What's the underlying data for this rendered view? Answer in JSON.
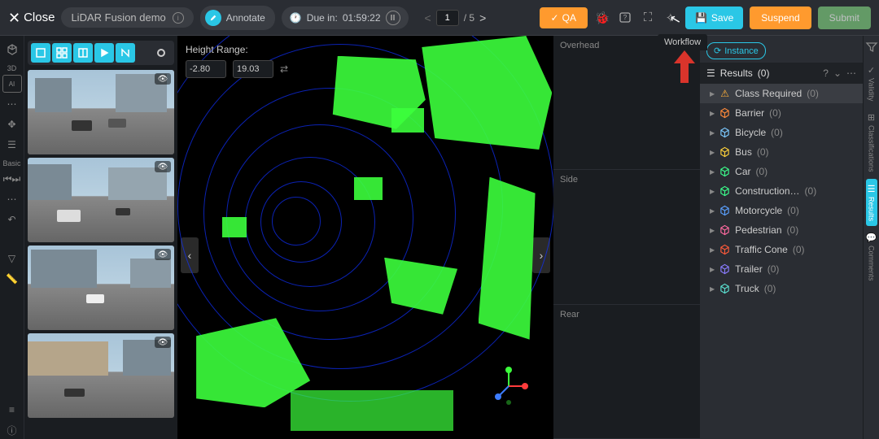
{
  "header": {
    "close": "Close",
    "title": "LiDAR Fusion demo",
    "annotate": "Annotate",
    "due_label": "Due in:",
    "due_time": "01:59:22",
    "page_current": "1",
    "page_total": "/ 5",
    "qa": "QA",
    "save": "Save",
    "suspend": "Suspend",
    "submit": "Submit"
  },
  "left_rail": {
    "label_3d": "3D",
    "label_basic": "Basic"
  },
  "height_range": {
    "label": "Height Range:",
    "min": "-2.80",
    "max": "19.03"
  },
  "ortho": {
    "overhead": "Overhead",
    "side": "Side",
    "rear": "Rear"
  },
  "panel": {
    "workflow": "Workflow",
    "instance": "Instance",
    "results_label": "Results",
    "results_count": "(0)",
    "rows": [
      {
        "label": "Class Required",
        "count": "(0)",
        "warn": true,
        "color": "#ffb03a"
      },
      {
        "label": "Barrier",
        "count": "(0)",
        "color": "#ff8a3a"
      },
      {
        "label": "Bicycle",
        "count": "(0)",
        "color": "#7cc9ff"
      },
      {
        "label": "Bus",
        "count": "(0)",
        "color": "#ffd23a"
      },
      {
        "label": "Car",
        "count": "(0)",
        "color": "#3cff8c"
      },
      {
        "label": "Construction…",
        "count": "(0)",
        "color": "#3cff8c"
      },
      {
        "label": "Motorcycle",
        "count": "(0)",
        "color": "#5aa0ff"
      },
      {
        "label": "Pedestrian",
        "count": "(0)",
        "color": "#ff6aa0"
      },
      {
        "label": "Traffic Cone",
        "count": "(0)",
        "color": "#ff5a3a"
      },
      {
        "label": "Trailer",
        "count": "(0)",
        "color": "#8a7cff"
      },
      {
        "label": "Truck",
        "count": "(0)",
        "color": "#5ae0d0"
      }
    ]
  },
  "far_rail": {
    "validity": "Validity",
    "classifications": "Classifications",
    "results": "Results",
    "comments": "Comments"
  }
}
